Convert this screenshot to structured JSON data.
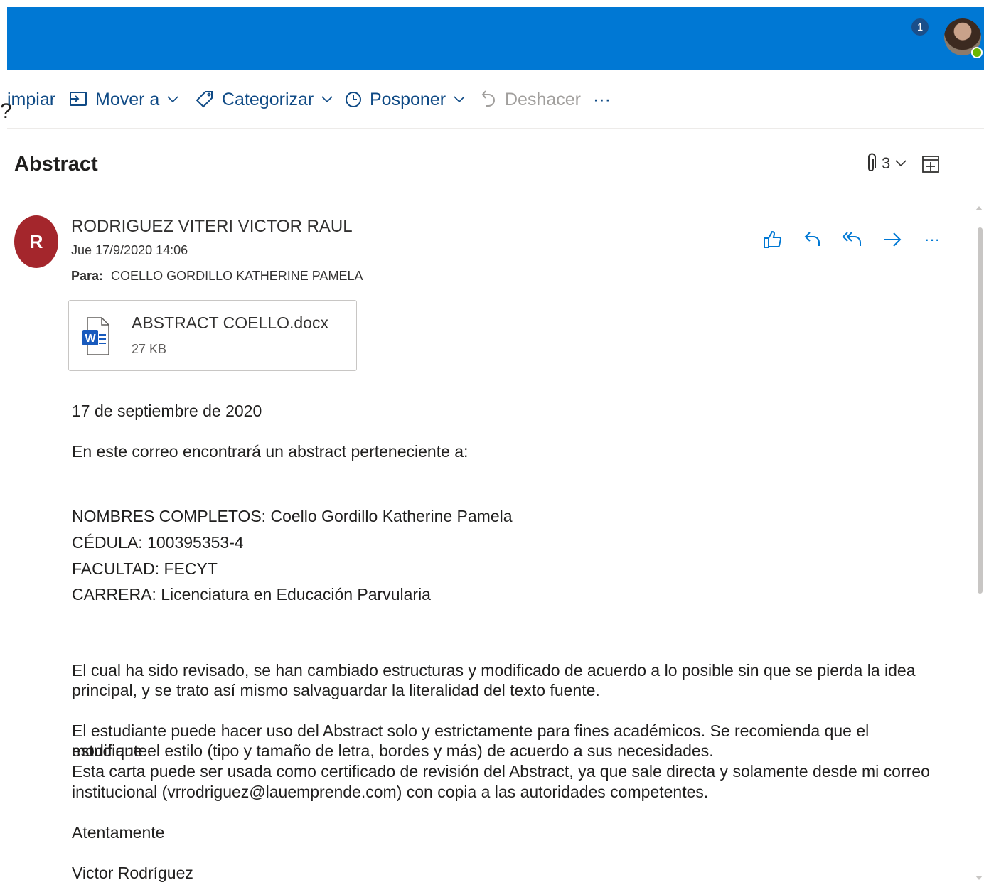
{
  "topbar": {
    "accent": "#0078d4",
    "icons": [
      "skype-icon",
      "calendar-check-icon",
      "bell-icon",
      "gear-icon",
      "help-icon",
      "megaphone-icon"
    ],
    "help_glyph": "?",
    "notification_count": "1"
  },
  "commands": {
    "clean_label": "impiar",
    "move_label": "Mover a",
    "categorize_label": "Categorizar",
    "snooze_label": "Posponer",
    "undo_label": "Deshacer",
    "more_label": "···"
  },
  "message": {
    "subject": "Abstract",
    "attachment_count": "3",
    "sender_initial": "R",
    "sender_name": "RODRIGUEZ VITERI VICTOR RAUL",
    "date": "Jue 17/9/2020 14:06",
    "to_label": "Para:",
    "to_value": "COELLO GORDILLO KATHERINE PAMELA",
    "more_actions": "···",
    "attachment": {
      "name": "ABSTRACT COELLO.docx",
      "size": "27 KB",
      "icon": "word-document-icon"
    },
    "body": {
      "date_line": "17 de septiembre de 2020",
      "intro": "En este correo encontrará un abstract  perteneciente a:",
      "names": "NOMBRES COMPLETOS:  Coello Gordillo Katherine Pamela",
      "id": "CÉDULA: 100395353-4",
      "faculty": "FACULTAD: FECYT",
      "career": "CARRERA: Licenciatura en Educación Parvularia",
      "para1_line1": "El cual ha sido revisado, se han cambiado estructuras y modificado de acuerdo a lo posible sin que se pierda la idea",
      "para1_line2": "principal, y se trato  así mismo salvaguardar la literalidad del texto fuente.",
      "para2_line1": "El estudiante puede hacer uso del Abstract solo y estrictamente para fines académicos. Se recomienda que el estudiante",
      "para2_line2": "modifique el estilo (tipo y tamaño de letra, bordes y más) de acuerdo a sus necesidades.",
      "para2_line3": "Esta carta puede ser usada como certificado de revisión del Abstract, ya que sale directa y solamente desde mi correo",
      "para2_line4": "institucional (vrrodriguez@lauemprende.com) con copia a las autoridades competentes.",
      "closing": "Atentamente",
      "signature": "Victor Rodríguez"
    }
  }
}
